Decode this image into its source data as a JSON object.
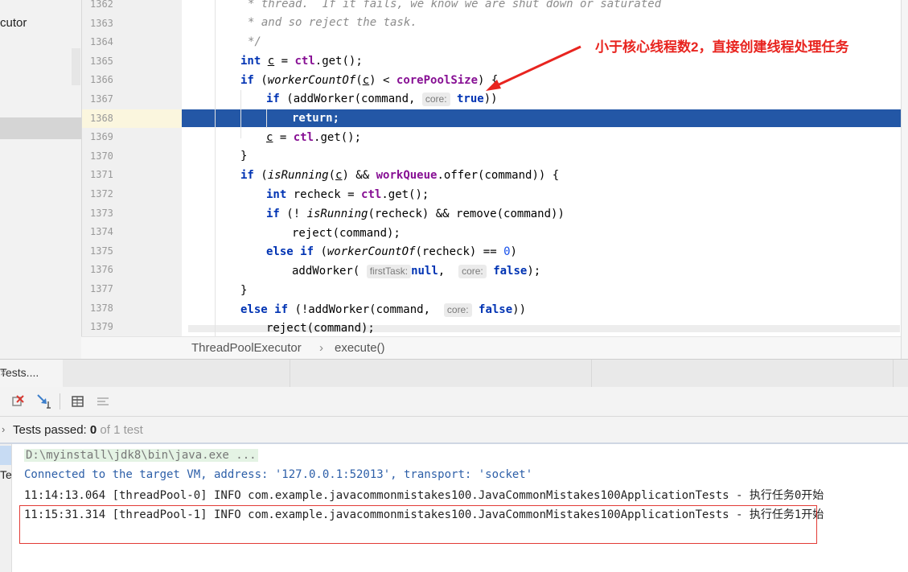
{
  "project_panel": {
    "class_name": "cutor"
  },
  "editor": {
    "line_numbers": [
      "1362",
      "1363",
      "1364",
      "1365",
      "1366",
      "1367",
      "1368",
      "1369",
      "1370",
      "1371",
      "1372",
      "1373",
      "1374",
      "1375",
      "1376",
      "1377",
      "1378",
      "1379"
    ],
    "comment_lines": [
      "* thread.  If it fails, we know we are shut down or saturated",
      "* and so reject the task.",
      "*/"
    ],
    "tokens": {
      "int": "int",
      "if": "if",
      "else": "else",
      "return": "return;",
      "true": "true",
      "false": "false",
      "null": "null",
      "zero": "0",
      "ctl": "ctl",
      "workQueue": "workQueue",
      "corePoolSize": "corePoolSize",
      "workerCountOf": "workerCountOf",
      "isRunning": "isRunning",
      "c": "c",
      "recheck": "recheck"
    },
    "hints": {
      "core": "core:",
      "firstTask": "firstTask:"
    }
  },
  "breadcrumb": {
    "class": "ThreadPoolExecutor",
    "separator": "›",
    "method": "execute()"
  },
  "annotation": "小于核心线程数2，直接创建线程处理任务",
  "run_panel": {
    "tab_label": "Tests....",
    "tab_close": "×",
    "status_chevron": "›",
    "status_prefix": "Tests passed: ",
    "status_count": "0",
    "status_suffix": " of 1 test",
    "side_label": "Te",
    "console": [
      "D:\\myinstall\\jdk8\\bin\\java.exe ...",
      "Connected to the target VM, address: '127.0.0.1:52013', transport: 'socket'",
      "11:14:13.064 [threadPool-0] INFO com.example.javacommonmistakes100.JavaCommonMistakes100ApplicationTests - 执行任务0开始",
      "11:15:31.314 [threadPool-1] INFO com.example.javacommonmistakes100.JavaCommonMistakes100ApplicationTests - 执行任务1开始"
    ]
  },
  "colors": {
    "highlight": "#2357a6",
    "annotation": "#e8241f",
    "keyword": "#0033b3",
    "field": "#871094"
  }
}
